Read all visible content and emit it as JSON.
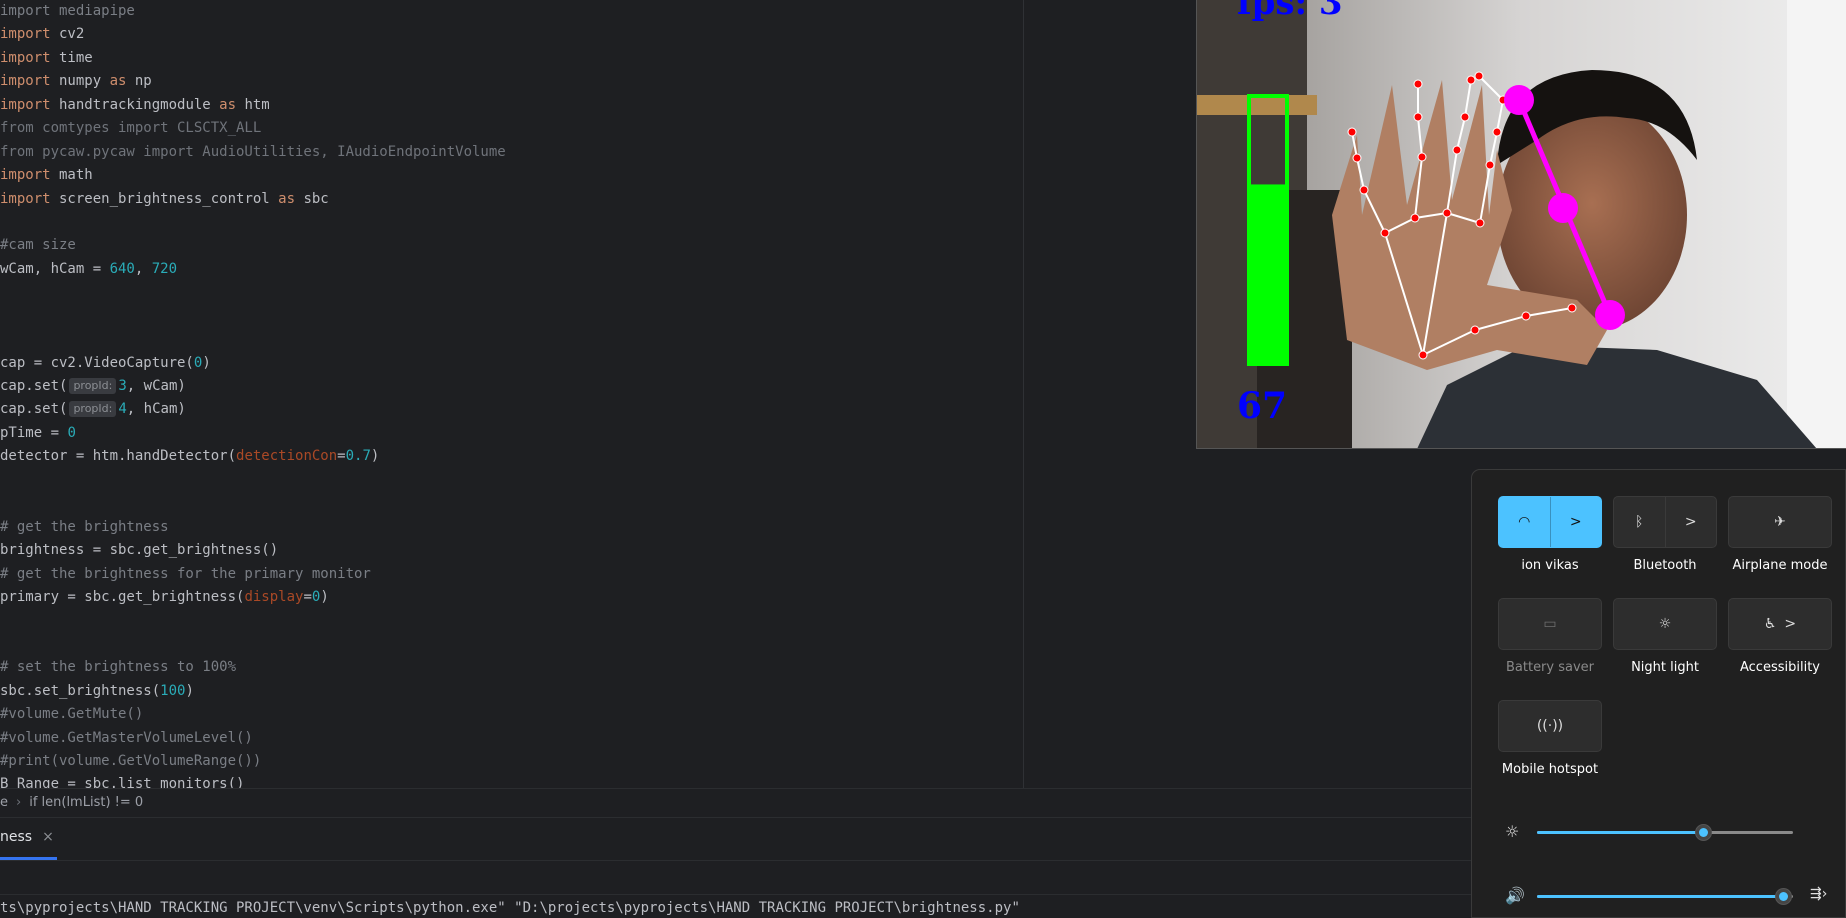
{
  "editor": {
    "lines": [
      [
        [
          "cmt",
          "import mediapipe"
        ]
      ],
      [
        [
          "kw",
          "import"
        ],
        [
          "",
          " cv2"
        ]
      ],
      [
        [
          "kw",
          "import"
        ],
        [
          "",
          " time"
        ]
      ],
      [
        [
          "kw",
          "import"
        ],
        [
          "",
          " numpy "
        ],
        [
          "kw",
          "as"
        ],
        [
          "",
          " np"
        ]
      ],
      [
        [
          "kw",
          "import"
        ],
        [
          "",
          " handtrackingmodule "
        ],
        [
          "kw",
          "as"
        ],
        [
          "",
          " htm"
        ]
      ],
      [
        [
          "dim",
          "from comtypes import CLSCTX_ALL"
        ]
      ],
      [
        [
          "dim",
          "from pycaw.pycaw import AudioUtilities, IAudioEndpointVolume"
        ]
      ],
      [
        [
          "kw",
          "import"
        ],
        [
          "",
          " math"
        ]
      ],
      [
        [
          "kw",
          "import"
        ],
        [
          "",
          " screen_brightness_control "
        ],
        [
          "kw",
          "as"
        ],
        [
          "",
          " sbc"
        ]
      ],
      [
        [
          "",
          ""
        ]
      ],
      [
        [
          "cmt",
          "#cam size"
        ]
      ],
      [
        [
          "",
          "wCam, hCam = "
        ],
        [
          "num",
          "640"
        ],
        [
          "",
          ", "
        ],
        [
          "num",
          "720"
        ]
      ],
      [
        [
          "",
          ""
        ]
      ],
      [
        [
          "",
          ""
        ]
      ],
      [
        [
          "",
          ""
        ]
      ],
      [
        [
          "",
          "cap = cv2.VideoCapture("
        ],
        [
          "num",
          "0"
        ],
        [
          "",
          ")"
        ]
      ],
      [
        [
          "",
          "cap.set("
        ],
        [
          "hint",
          "propId:"
        ],
        [
          "num",
          "3"
        ],
        [
          "",
          ", wCam)"
        ]
      ],
      [
        [
          "",
          "cap.set("
        ],
        [
          "hint",
          "propId:"
        ],
        [
          "num",
          "4"
        ],
        [
          "",
          ", hCam)"
        ]
      ],
      [
        [
          "",
          "pTime = "
        ],
        [
          "num",
          "0"
        ]
      ],
      [
        [
          "",
          "detector = htm.handDetector("
        ],
        [
          "param",
          "detectionCon"
        ],
        [
          "",
          "="
        ],
        [
          "num",
          "0.7"
        ],
        [
          "",
          ")"
        ]
      ],
      [
        [
          "",
          ""
        ]
      ],
      [
        [
          "",
          ""
        ]
      ],
      [
        [
          "cmt",
          "# get the brightness"
        ]
      ],
      [
        [
          "",
          "brightness = sbc.get_brightness()"
        ]
      ],
      [
        [
          "cmt",
          "# get the brightness for the primary monitor"
        ]
      ],
      [
        [
          "",
          "primary = sbc.get_brightness("
        ],
        [
          "param",
          "display"
        ],
        [
          "",
          "="
        ],
        [
          "num",
          "0"
        ],
        [
          "",
          ")"
        ]
      ],
      [
        [
          "",
          ""
        ]
      ],
      [
        [
          "",
          ""
        ]
      ],
      [
        [
          "cmt",
          "# set the brightness to 100%"
        ]
      ],
      [
        [
          "",
          "sbc.set_brightness("
        ],
        [
          "num",
          "100"
        ],
        [
          "",
          ")"
        ]
      ],
      [
        [
          "cmt",
          "#volume.GetMute()"
        ]
      ],
      [
        [
          "cmt",
          "#volume.GetMasterVolumeLevel()"
        ]
      ],
      [
        [
          "cmt",
          "#print(volume.GetVolumeRange())"
        ]
      ],
      [
        [
          "",
          "B_Range = sbc.list_monitors()"
        ]
      ]
    ]
  },
  "breadcrumb": {
    "items": [
      "e",
      "if len(lmList) != 0"
    ]
  },
  "run": {
    "tab_label": "ness",
    "close_glyph": "×",
    "output_line": "ts\\pyprojects\\HAND TRACKING PROJECT\\venv\\Scripts\\python.exe\" \"D:\\projects\\pyprojects\\HAND TRACKING PROJECT\\brightness.py\""
  },
  "camera": {
    "fps_text": "fps: 3",
    "level_text": "67",
    "level_fraction": 0.67,
    "colors": {
      "bar": "#00ff00",
      "text": "#0000ff",
      "landmark_line": "#ffffff",
      "landmark_point": "#ff0000",
      "pinch": "#ff00ff"
    }
  },
  "quick_settings": {
    "tiles": [
      {
        "label": "ion vikas",
        "icon": "wifi-icon",
        "glyph": "◠",
        "state": "on",
        "split": true,
        "chevron": ">"
      },
      {
        "label": "Bluetooth",
        "icon": "bluetooth-icon",
        "glyph": "ᛒ",
        "state": "off",
        "split": true,
        "chevron": ">"
      },
      {
        "label": "Airplane mode",
        "icon": "airplane-icon",
        "glyph": "✈",
        "state": "off",
        "split": false
      },
      {
        "label": "Battery saver",
        "icon": "battery-saver-icon",
        "glyph": "▭",
        "state": "disabled",
        "split": false
      },
      {
        "label": "Night light",
        "icon": "night-light-icon",
        "glyph": "☼",
        "state": "off",
        "split": false
      },
      {
        "label": "Accessibility",
        "icon": "accessibility-icon",
        "glyph": "♿",
        "state": "off",
        "split": false,
        "chevron": ">"
      },
      {
        "label": "Mobile hotspot",
        "icon": "mobile-hotspot-icon",
        "glyph": "((·))",
        "state": "off",
        "split": false
      }
    ],
    "brightness": {
      "icon": "brightness-icon",
      "glyph": "☼",
      "value": 0.65
    },
    "volume": {
      "icon": "volume-icon",
      "glyph": "🔊",
      "value": 0.96,
      "extra_glyph": "⇶›"
    },
    "colors": {
      "accent": "#4cc2ff",
      "panel": "#202020",
      "tile": "#2d2d2d"
    }
  }
}
